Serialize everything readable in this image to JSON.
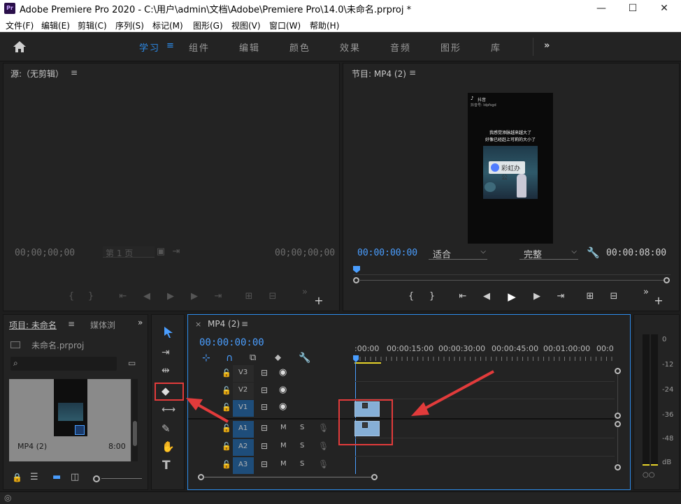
{
  "titlebar": {
    "app_logo": "Pr",
    "title": "Adobe Premiere Pro 2020 - C:\\用户\\admin\\文档\\Adobe\\Premiere Pro\\14.0\\未命名.prproj *",
    "minimize": "—",
    "maximize": "☐",
    "close": "✕"
  },
  "menu": [
    "文件(F)",
    "编辑(E)",
    "剪辑(C)",
    "序列(S)",
    "标记(M)",
    "图形(G)",
    "视图(V)",
    "窗口(W)",
    "帮助(H)"
  ],
  "workspaces": {
    "tabs": [
      "学习",
      "组件",
      "编辑",
      "颜色",
      "效果",
      "音频",
      "图形",
      "库"
    ],
    "active": "学习",
    "menu_icon": "≡",
    "more": "»"
  },
  "source_monitor": {
    "title": "源:（无剪辑）",
    "menu_icon": "≡",
    "timecode_left": "00;00;00;00",
    "page_label": "第 1 页",
    "timecode_right": "00;00;00;00"
  },
  "program_monitor": {
    "title": "节目: MP4 (2)",
    "menu_icon": "≡",
    "timecode": "00:00:00:00",
    "fit_option": "适合",
    "quality_option": "完整",
    "duration": "00:00:08:00",
    "video": {
      "app_name": "抖音",
      "user_id": "抖音号: ldpfsgd",
      "caption_line1": "我感觉添脉越来越大了",
      "caption_line2": "好像已经赶上可莉的大小了",
      "watermark": "彩虹办公"
    }
  },
  "project_panel": {
    "tab_project": "项目: 未命名",
    "tab_media": "媒体浏",
    "menu_icon": "≡",
    "more": "»",
    "file_name": "未命名.prproj",
    "search_placeholder": "",
    "item_name": "MP4 (2)",
    "item_duration": "8:00"
  },
  "timeline": {
    "close": "×",
    "sequence_name": "MP4 (2)",
    "menu_icon": "≡",
    "timecode": "00:00:00:00",
    "ruler": [
      ":00:00",
      "00:00:15:00",
      "00:00:30:00",
      "00:00:45:00",
      "00:01:00:00",
      "00:0"
    ],
    "video_tracks": [
      "V3",
      "V2",
      "V1"
    ],
    "audio_tracks": [
      "A1",
      "A2",
      "A3"
    ],
    "mute": "M",
    "solo": "S"
  },
  "audio_meter": {
    "scale": [
      "0",
      "-12",
      "-24",
      "-36",
      "-48",
      "dB"
    ],
    "solo_buttons": "○○"
  },
  "colors": {
    "accent": "#2d8ceb",
    "timecode": "#4a9eff",
    "annotation": "#e23b3b",
    "clip": "#86afd6",
    "selected_track": "#1e4d7a"
  }
}
